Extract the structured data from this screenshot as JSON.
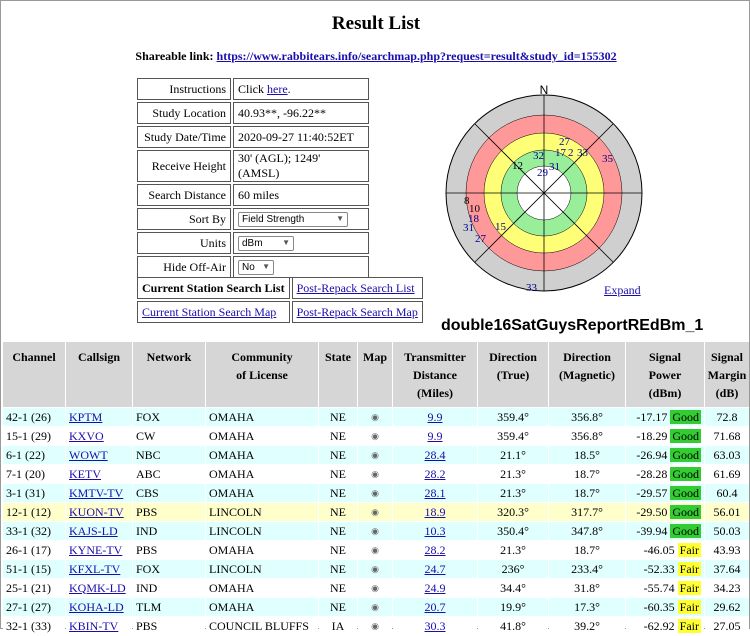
{
  "page": {
    "title": "Result List"
  },
  "share": {
    "label": "Shareable link:",
    "url": "https://www.rabbitears.info/searchmap.php?request=result&study_id=155302"
  },
  "info": {
    "instructions_label": "Instructions",
    "instructions_prefix": "Click ",
    "instructions_link": "here",
    "instructions_suffix": ".",
    "location_label": "Study Location",
    "location_value": "40.93**, -96.22**",
    "date_label": "Study Date/Time",
    "date_value": "2020-09-27 11:40:52ET",
    "height_label": "Receive Height",
    "height_value": "30' (AGL); 1249' (AMSL)",
    "distance_label": "Search Distance",
    "distance_value": "60 miles",
    "sortby_label": "Sort By",
    "sortby_value": "Field Strength",
    "units_label": "Units",
    "units_value": "dBm",
    "hide_label": "Hide Off-Air",
    "hide_value": "No"
  },
  "buttons": {
    "current_list": "Current Station Search List",
    "post_list": "Post-Repack Search List",
    "current_map": "Current Station Search Map",
    "post_map": "Post-Repack Search Map"
  },
  "radar": {
    "north": "N",
    "colors": {
      "outer": "#cfcfcf",
      "red": "#ff9999",
      "yellow": "#ffff77",
      "green": "#99ee99"
    },
    "labels": [
      "27",
      "32",
      "17",
      "2",
      "33",
      "35",
      "12",
      "29",
      "31",
      "8",
      "10",
      "18",
      "31",
      "15",
      "27",
      "33"
    ]
  },
  "expand": "Expand",
  "study_name": "double16SatGuysReportREdBm_1",
  "table": {
    "headers": {
      "channel": "Channel",
      "callsign": "Callsign",
      "network": "Network",
      "community_1": "Community",
      "community_2": "of License",
      "state": "State",
      "map": "Map",
      "dist_1": "Transmitter",
      "dist_2": "Distance",
      "dist_3": "(Miles)",
      "dirt_1": "Direction",
      "dirt_2": "(True)",
      "dirm_1": "Direction",
      "dirm_2": "(Magnetic)",
      "pow_1": "Signal",
      "pow_2": "Power",
      "pow_3": "(dBm)",
      "mar_1": "Signal",
      "mar_2": "Margin",
      "mar_3": "(dB)"
    },
    "rows": [
      {
        "ch": "42-1 (26)",
        "call": "KPTM",
        "net": "FOX",
        "comm": "OMAHA",
        "st": "NE",
        "dist": "9.9",
        "dt": "359.4°",
        "dm": "356.8°",
        "pow": "-17.17",
        "q": "Good",
        "mar": "72.8",
        "bg": "c"
      },
      {
        "ch": "15-1 (29)",
        "call": "KXVO",
        "net": "CW",
        "comm": "OMAHA",
        "st": "NE",
        "dist": "9.9",
        "dt": "359.4°",
        "dm": "356.8°",
        "pow": "-18.29",
        "q": "Good",
        "mar": "71.68",
        "bg": "w"
      },
      {
        "ch": "6-1 (22)",
        "call": "WOWT",
        "net": "NBC",
        "comm": "OMAHA",
        "st": "NE",
        "dist": "28.4",
        "dt": "21.1°",
        "dm": "18.5°",
        "pow": "-26.94",
        "q": "Good",
        "mar": "63.03",
        "bg": "c"
      },
      {
        "ch": "7-1 (20)",
        "call": "KETV",
        "net": "ABC",
        "comm": "OMAHA",
        "st": "NE",
        "dist": "28.2",
        "dt": "21.3°",
        "dm": "18.7°",
        "pow": "-28.28",
        "q": "Good",
        "mar": "61.69",
        "bg": "w"
      },
      {
        "ch": "3-1 (31)",
        "call": "KMTV-TV",
        "net": "CBS",
        "comm": "OMAHA",
        "st": "NE",
        "dist": "28.1",
        "dt": "21.3°",
        "dm": "18.7°",
        "pow": "-29.57",
        "q": "Good",
        "mar": "60.4",
        "bg": "c"
      },
      {
        "ch": "12-1 (12)",
        "call": "KUON-TV",
        "net": "PBS",
        "comm": "LINCOLN",
        "st": "NE",
        "dist": "18.9",
        "dt": "320.3°",
        "dm": "317.7°",
        "pow": "-29.50",
        "q": "Good",
        "mar": "56.01",
        "bg": "y"
      },
      {
        "ch": "33-1 (32)",
        "call": "KAJS-LD",
        "net": "IND",
        "comm": "LINCOLN",
        "st": "NE",
        "dist": "10.3",
        "dt": "350.4°",
        "dm": "347.8°",
        "pow": "-39.94",
        "q": "Good",
        "mar": "50.03",
        "bg": "c"
      },
      {
        "ch": "26-1 (17)",
        "call": "KYNE-TV",
        "net": "PBS",
        "comm": "OMAHA",
        "st": "NE",
        "dist": "28.2",
        "dt": "21.3°",
        "dm": "18.7°",
        "pow": "-46.05",
        "q": "Fair",
        "mar": "43.93",
        "bg": "w"
      },
      {
        "ch": "51-1 (15)",
        "call": "KFXL-TV",
        "net": "FOX",
        "comm": "LINCOLN",
        "st": "NE",
        "dist": "24.7",
        "dt": "236°",
        "dm": "233.4°",
        "pow": "-52.33",
        "q": "Fair",
        "mar": "37.64",
        "bg": "c"
      },
      {
        "ch": "25-1 (21)",
        "call": "KQMK-LD",
        "net": "IND",
        "comm": "OMAHA",
        "st": "NE",
        "dist": "24.9",
        "dt": "34.4°",
        "dm": "31.8°",
        "pow": "-55.74",
        "q": "Fair",
        "mar": "34.23",
        "bg": "w"
      },
      {
        "ch": "27-1 (27)",
        "call": "KOHA-LD",
        "net": "TLM",
        "comm": "OMAHA",
        "st": "NE",
        "dist": "20.7",
        "dt": "19.9°",
        "dm": "17.3°",
        "pow": "-60.35",
        "q": "Fair",
        "mar": "29.62",
        "bg": "c"
      },
      {
        "ch": "32-1 (33)",
        "call": "KBIN-TV",
        "net": "PBS",
        "comm": "COUNCIL BLUFFS",
        "st": "IA",
        "dist": "30.3",
        "dt": "41.8°",
        "dm": "39.2°",
        "pow": "-62.92",
        "q": "Fair",
        "mar": "27.05",
        "bg": "w"
      }
    ]
  }
}
